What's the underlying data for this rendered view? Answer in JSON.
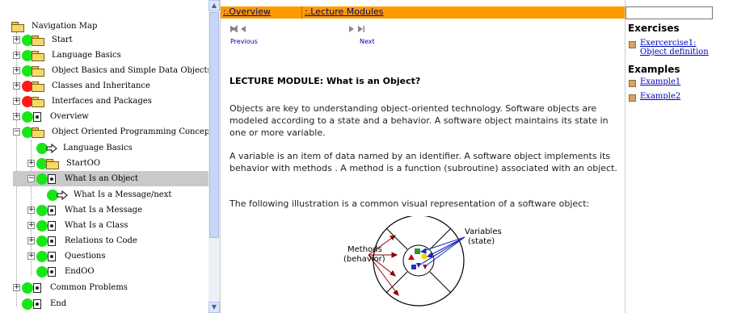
{
  "nav": {
    "title": "Navigation Map",
    "items": [
      {
        "label": "Start",
        "status": "green",
        "icon": "folder",
        "expander": "+"
      },
      {
        "label": "Language Basics",
        "status": "green",
        "icon": "folder",
        "expander": "+"
      },
      {
        "label": "Object Basics and Simple Data Objects",
        "status": "green",
        "icon": "folder",
        "expander": "+"
      },
      {
        "label": "Classes and Inheritance",
        "status": "red",
        "icon": "folder",
        "expander": "+"
      },
      {
        "label": "Interfaces and Packages",
        "status": "red",
        "icon": "folder",
        "expander": "+"
      },
      {
        "label": "Overview",
        "status": "green",
        "icon": "document",
        "expander": "+"
      },
      {
        "label": "Object Oriented Programming Concepts",
        "status": "green",
        "icon": "folder",
        "expander": "−"
      },
      {
        "label": "Language Basics",
        "status": "green",
        "icon": "arrow",
        "expander": ""
      },
      {
        "label": "StartOO",
        "status": "green",
        "icon": "folder",
        "expander": "+"
      },
      {
        "label": "What Is an Object",
        "status": "green",
        "icon": "document",
        "expander": "−",
        "selected": true
      },
      {
        "label": "What Is a Message/next",
        "status": "green",
        "icon": "arrow",
        "expander": ""
      },
      {
        "label": "What Is a Message",
        "status": "green",
        "icon": "document",
        "expander": "+"
      },
      {
        "label": "What Is a Class",
        "status": "green",
        "icon": "document",
        "expander": "+"
      },
      {
        "label": "Relations to Code",
        "status": "green",
        "icon": "document",
        "expander": "+"
      },
      {
        "label": "Questions",
        "status": "green",
        "icon": "document",
        "expander": "+"
      },
      {
        "label": "EndOO",
        "status": "green",
        "icon": "document",
        "expander": ""
      },
      {
        "label": "Common Problems",
        "status": "green",
        "icon": "document",
        "expander": "+"
      },
      {
        "label": "End",
        "status": "green",
        "icon": "document",
        "expander": ""
      }
    ]
  },
  "tabs": [
    {
      "label": ":.Overview"
    },
    {
      "label": ":.Lecture Modules"
    }
  ],
  "pager": {
    "previous": "Previous",
    "next": "Next",
    "first_icon": "first-page-icon",
    "prev_icon": "prev-page-icon",
    "next_icon": "next-page-icon",
    "last_icon": "last-page-icon"
  },
  "lecture": {
    "title": "LECTURE MODULE: What is an Object?",
    "paragraphs": [
      "Objects are key to understanding object-oriented technology. Software objects are modeled according to a state and a behavior. A software object maintains its state in one or more variable.",
      "A variable is an item of data named by an identifier. A software object implements its behavior with methods . A method is a function (subroutine) associated with an object.",
      "The following illustration is a common visual representation of a software object:"
    ]
  },
  "diagram": {
    "methods_label_1": "Methods",
    "methods_label_2": "(behavior)",
    "variables_label_1": "Variables",
    "variables_label_2": "(state)"
  },
  "sidebar": {
    "exercises_heading": "Exercises",
    "exercises": [
      {
        "label_1": "Exercercise1:",
        "label_2": "Object definition"
      }
    ],
    "examples_heading": "Examples",
    "examples": [
      {
        "label": "Example1"
      },
      {
        "label": "Example2"
      }
    ]
  },
  "colors": {
    "accent": "#ff9900",
    "link": "#0000c0",
    "status_green": "#19e619",
    "status_red": "#ff1a1a"
  }
}
